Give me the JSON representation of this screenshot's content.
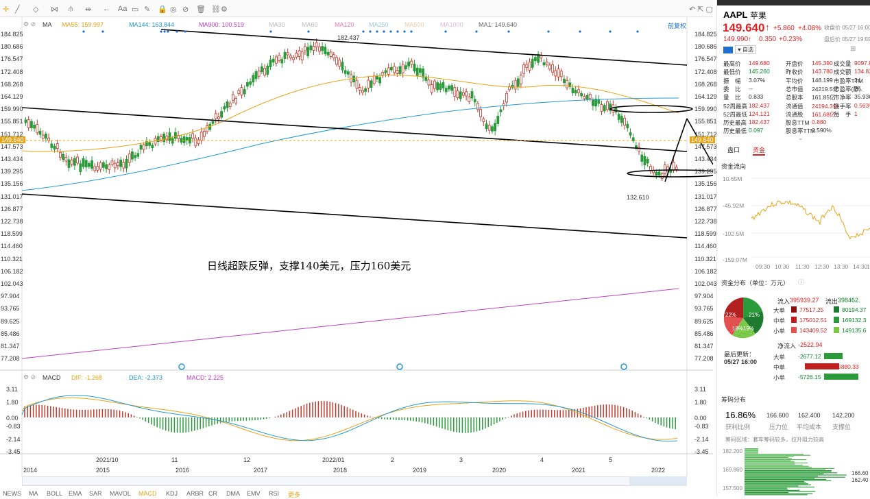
{
  "toolbar": {
    "items": [
      "画线",
      "形态",
      "指标",
      "十字",
      "区间",
      "放大",
      "缩小"
    ]
  },
  "indicators": {
    "ma_label": "MA",
    "ma55": "MA55: 159.997",
    "ma144": "MA144: 163.844",
    "ma900": "MA900: 100.519",
    "ma30": "MA30",
    "ma60": "MA60",
    "ma120": "MA120",
    "ma250": "MA250",
    "ma500": "MA500",
    "ma1000": "MA1000",
    "ma1": "MA1: 149.640",
    "fq": "前复权"
  },
  "price_axis": [
    "184.825",
    "180.686",
    "176.547",
    "172.408",
    "168.268",
    "164.129",
    "159.990",
    "155.851",
    "151.712",
    "147.573",
    "143.434",
    "139.295",
    "135.156",
    "131.017",
    "126.877",
    "122.738",
    "118.599",
    "114.460",
    "110.321",
    "106.182",
    "102.043",
    "97.904",
    "93.765",
    "89.625",
    "85.486",
    "81.347",
    "77.208"
  ],
  "left_axis": [
    "184.825",
    "180.686",
    "176.547",
    "172.408",
    "168.268",
    "164.129",
    "159.990",
    "155.851",
    "151.712",
    "147.573",
    "143.434",
    "139.295",
    "135.156",
    "131.017",
    "126.877",
    "122.738",
    "118.599",
    "114.460",
    "110.321",
    "106.182",
    "102.043",
    "97.904",
    "93.765",
    "89.625",
    "85.486",
    "81.347",
    "77.208"
  ],
  "current_price_tag": "149.640",
  "high_mark": "182.437",
  "low_mark": "132.610",
  "annotation": "日线超跌反弹，支撑140美元，压力160美元",
  "macd": {
    "label": "MACD",
    "dif": "DIF: -1.268",
    "dea": "DEA: -2.373",
    "macd": "MACD: 2.225",
    "axis": [
      "3.11",
      "1.80",
      "0.00",
      "-0.83",
      "-2.14",
      "-3.45"
    ]
  },
  "date_axis": [
    "2021/10",
    "11",
    "12",
    "2022/01",
    "2",
    "3",
    "4",
    "5"
  ],
  "year_axis": [
    "2014",
    "2015",
    "2016",
    "2017",
    "2018",
    "2019",
    "2020",
    "2021",
    "2022"
  ],
  "bottom_tabs": [
    "NEWS",
    "MA",
    "BOLL",
    "EMA",
    "SAR",
    "MAVOL",
    "MACD",
    "KDJ",
    "ARBR",
    "CR",
    "DMA",
    "EMV",
    "RSI",
    "更多"
  ],
  "quote": {
    "symbol": "AAPL",
    "name": "苹果",
    "price": "149.640",
    "arrow": "↑",
    "change": "+5.860",
    "pct": "+4.08%",
    "after_price": "149.990↑",
    "after_change": "0.350",
    "after_pct": "+0.23%",
    "close_time": "收盘价 05/27 16:00",
    "after_time": "盘后价 05/27 19:59",
    "fav": "自选"
  },
  "stats": [
    [
      "最高价",
      "149.680",
      "开盘价",
      "145.390",
      "成交量",
      "9097.8"
    ],
    [
      "最低价",
      "145.260",
      "昨收价",
      "143.780",
      "成交额",
      "134.83"
    ],
    [
      "振　幅",
      "3.07%",
      "平均价",
      "148.199",
      "市盈率TTM",
      "24"
    ],
    [
      "委　比",
      "--",
      "总市值",
      "24219.5亿",
      "市盈率(静)",
      "26."
    ],
    [
      "量　比",
      "0.833",
      "总股本",
      "161.85亿",
      "市净率",
      "35.936"
    ],
    [
      "52周最高",
      "182.437",
      "流通值",
      "24194.3亿",
      "换手率",
      "0.563%"
    ],
    [
      "52周最低",
      "124.121",
      "流通股",
      "161.68亿",
      "每　手",
      "1"
    ],
    [
      "历史最高",
      "182.437",
      "股息TTM",
      "0.880",
      "",
      ""
    ],
    [
      "历史最低",
      "0.097",
      "股息率TTM",
      "0.590%",
      "",
      ""
    ]
  ],
  "tabs": {
    "pankou": "盘口",
    "zijin": "资金"
  },
  "flow": {
    "title": "资金流向",
    "axis": [
      "10.65M",
      "-45.92M",
      "-102.5M",
      "-159.07M"
    ],
    "times": [
      "09:30",
      "10:30",
      "11:30",
      "12:30",
      "13:30",
      "14:30",
      "1"
    ]
  },
  "dist": {
    "title": "资金分布（单位：万元）",
    "pie": [
      "22%",
      "21%",
      "18%",
      "19%"
    ],
    "in_label": "流入",
    "in_val": "395939.27",
    "out_label": "流出",
    "out_val": "398462.",
    "rows": [
      [
        "大单",
        "77517.25",
        "80194.37"
      ],
      [
        "中单",
        "175012.51",
        "169132.3"
      ],
      [
        "小单",
        "143409.52",
        "149135.6"
      ]
    ],
    "net_label": "净流入",
    "net_val": "-2522.94",
    "update_label": "最后更新：",
    "update_time": "05/27 16:00",
    "nets": [
      [
        "大单",
        "-2677.12"
      ],
      [
        "中单",
        "5880.33"
      ],
      [
        "小单",
        "-5726.15"
      ]
    ]
  },
  "chips": {
    "title": "筹码分布",
    "profit": "16.86%",
    "profit_label": "获利比例",
    "p1": "166.600",
    "p1_label": "压力位",
    "p2": "162.400",
    "p2_label": "平均成本",
    "p3": "142.200",
    "p3_label": "支撑位",
    "note": "筹码区域：套牢筹码较多，拉升阻力较高",
    "axis": [
      "182.200",
      "169.860",
      "157.500"
    ],
    "tags": [
      "166.60",
      "162.40"
    ]
  }
}
